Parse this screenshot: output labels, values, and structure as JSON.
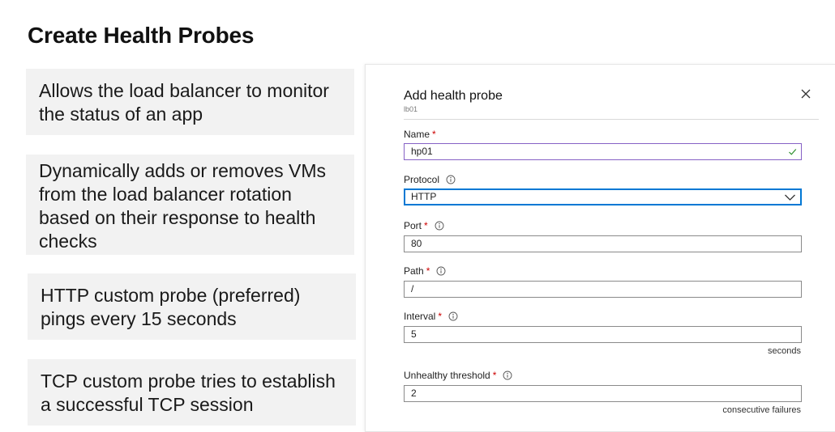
{
  "slide": {
    "title": "Create Health Probes",
    "bullets": [
      "Allows the load balancer to monitor the status of an app",
      "Dynamically adds or removes VMs from the load balancer rotation based on their response to health checks",
      "HTTP custom probe (preferred) pings every 15 seconds",
      "TCP custom probe tries to establish a successful TCP session"
    ]
  },
  "panel": {
    "title": "Add health probe",
    "subtitle": "lb01",
    "close_icon": "close-icon",
    "fields": {
      "name": {
        "label": "Name",
        "required": "*",
        "value": "hp01",
        "status_icon": "check-icon"
      },
      "protocol": {
        "label": "Protocol",
        "value": "HTTP",
        "info_icon": "info-icon",
        "dropdown_icon": "chevron-down-icon"
      },
      "port": {
        "label": "Port",
        "required": "*",
        "value": "80",
        "info_icon": "info-icon"
      },
      "path": {
        "label": "Path",
        "required": "*",
        "value": "/",
        "info_icon": "info-icon"
      },
      "interval": {
        "label": "Interval",
        "required": "*",
        "value": "5",
        "suffix": "seconds",
        "info_icon": "info-icon"
      },
      "unhealthy": {
        "label": "Unhealthy threshold",
        "required": "*",
        "value": "2",
        "suffix": "consecutive failures",
        "info_icon": "info-icon"
      }
    }
  },
  "colors": {
    "bullet_bg": "#f2f2f2",
    "required": "#cc0000",
    "valid_border": "#8661c5",
    "valid_check": "#2d8f2d",
    "focus_border": "#0078d4"
  }
}
